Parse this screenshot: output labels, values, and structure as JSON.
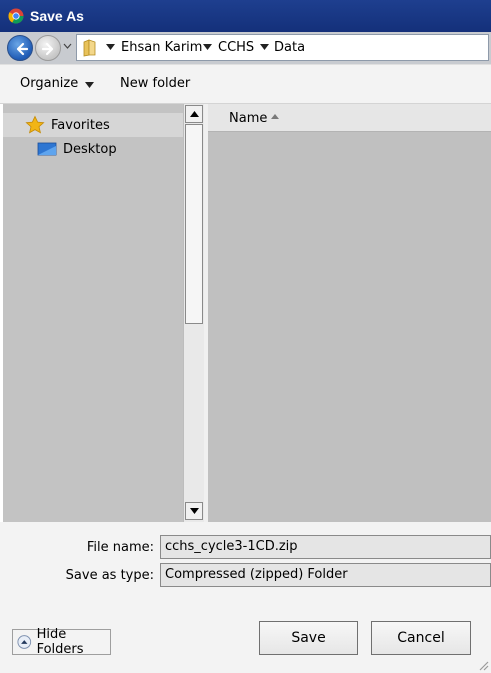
{
  "window": {
    "title": "Save As"
  },
  "address": {
    "crumbs": [
      "Ehsan Karim",
      "CCHS",
      "Data"
    ]
  },
  "toolbar": {
    "organize_label": "Organize",
    "new_folder_label": "New folder"
  },
  "nav": {
    "items": [
      {
        "label": "Favorites",
        "icon": "star-icon"
      },
      {
        "label": "Desktop",
        "icon": "desktop-icon"
      }
    ]
  },
  "file_list": {
    "column_name": "Name"
  },
  "form": {
    "file_name_label": "File name:",
    "file_name_value": "cchs_cycle3-1CD.zip",
    "save_type_label": "Save as type:",
    "save_type_value": "Compressed (zipped) Folder"
  },
  "buttons": {
    "save_label": "Save",
    "cancel_label": "Cancel",
    "hide_folders_label": "Hide Folders"
  },
  "colors": {
    "title_bar": "#1e3f8f",
    "pane_gray": "#c0c0c0"
  }
}
